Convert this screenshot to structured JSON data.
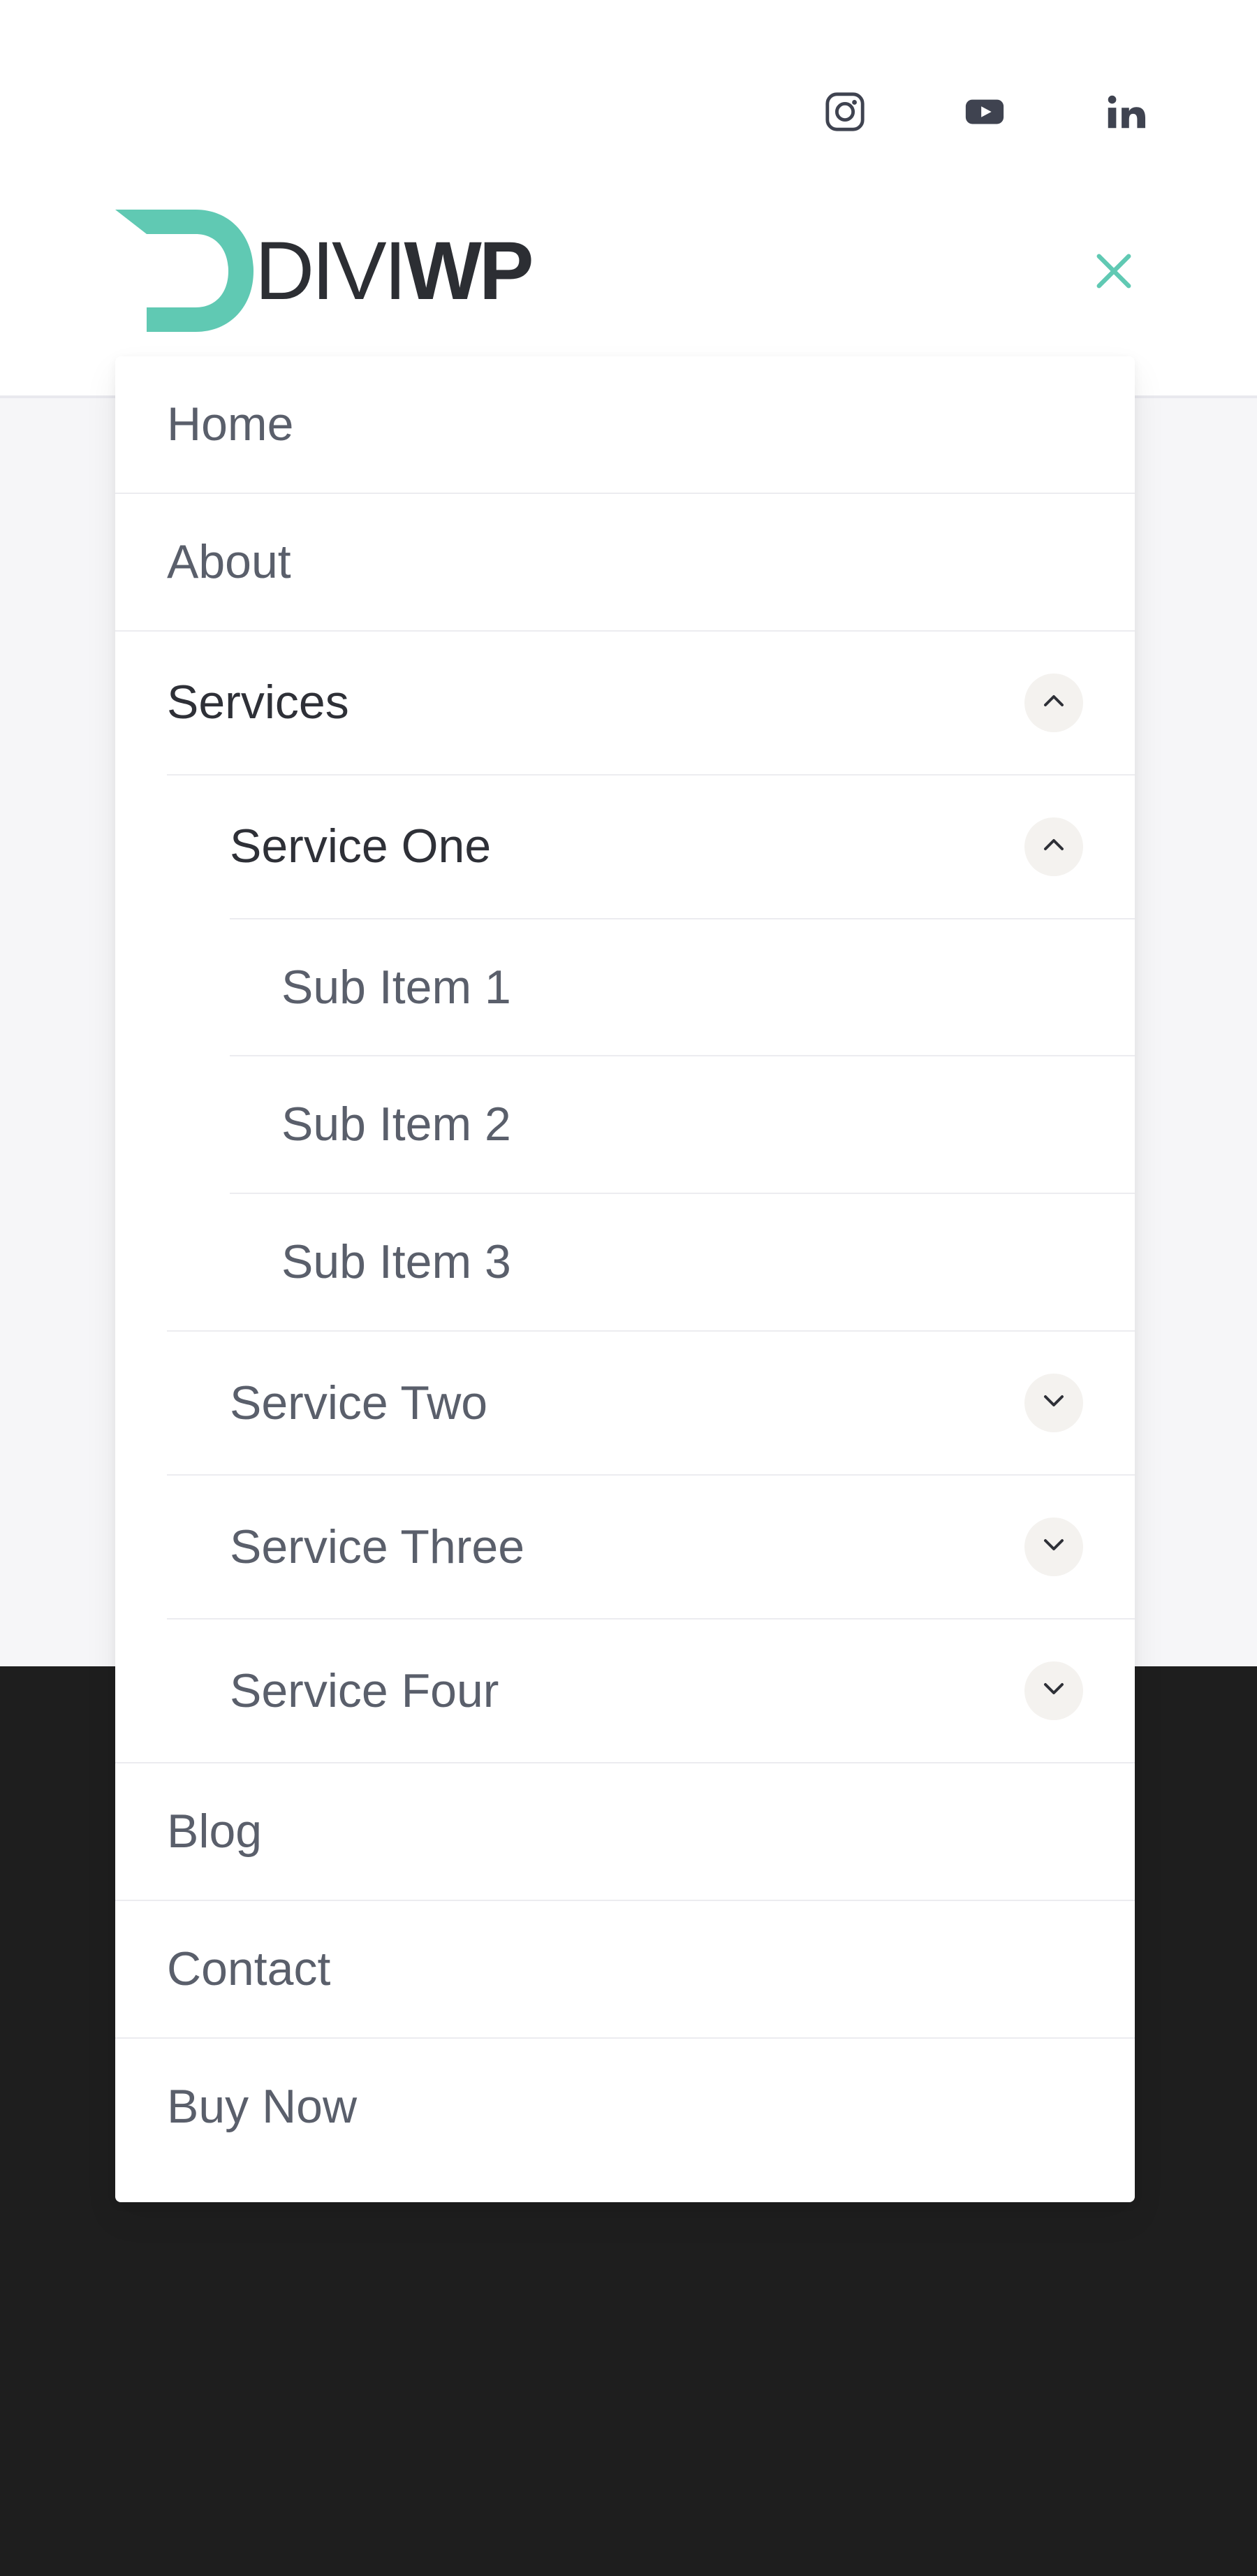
{
  "brand": {
    "name_thin": "DIVI",
    "name_bold": "WP"
  },
  "social": [
    {
      "id": "instagram",
      "icon": "instagram-icon"
    },
    {
      "id": "youtube",
      "icon": "youtube-icon"
    },
    {
      "id": "linkedin",
      "icon": "linkedin-icon"
    }
  ],
  "menu": {
    "items": [
      {
        "label": "Home"
      },
      {
        "label": "About"
      },
      {
        "label": "Services",
        "expanded": true,
        "children": [
          {
            "label": "Service One",
            "expanded": true,
            "children": [
              {
                "label": "Sub Item 1"
              },
              {
                "label": "Sub Item 2"
              },
              {
                "label": "Sub Item 3"
              }
            ]
          },
          {
            "label": "Service Two",
            "expanded": false,
            "has_children": true
          },
          {
            "label": "Service Three",
            "expanded": false,
            "has_children": true
          },
          {
            "label": "Service Four",
            "expanded": false,
            "has_children": true
          }
        ]
      },
      {
        "label": "Blog"
      },
      {
        "label": "Contact"
      },
      {
        "label": "Buy Now"
      }
    ]
  },
  "colors": {
    "accent": "#60c9b3",
    "text": "#5a5f6b",
    "active_text": "#2e3037",
    "chip_bg": "#f4f2ef",
    "dark_band": "#1e1e1e"
  }
}
